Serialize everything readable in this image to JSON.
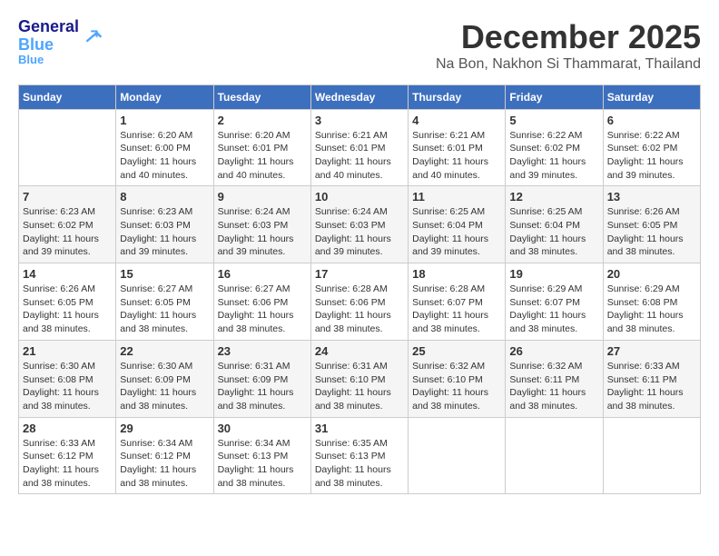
{
  "header": {
    "logo_line1": "General",
    "logo_line2": "Blue",
    "month": "December 2025",
    "location": "Na Bon, Nakhon Si Thammarat, Thailand"
  },
  "days_of_week": [
    "Sunday",
    "Monday",
    "Tuesday",
    "Wednesday",
    "Thursday",
    "Friday",
    "Saturday"
  ],
  "weeks": [
    [
      {
        "day": "",
        "info": ""
      },
      {
        "day": "1",
        "info": "Sunrise: 6:20 AM\nSunset: 6:00 PM\nDaylight: 11 hours\nand 40 minutes."
      },
      {
        "day": "2",
        "info": "Sunrise: 6:20 AM\nSunset: 6:01 PM\nDaylight: 11 hours\nand 40 minutes."
      },
      {
        "day": "3",
        "info": "Sunrise: 6:21 AM\nSunset: 6:01 PM\nDaylight: 11 hours\nand 40 minutes."
      },
      {
        "day": "4",
        "info": "Sunrise: 6:21 AM\nSunset: 6:01 PM\nDaylight: 11 hours\nand 40 minutes."
      },
      {
        "day": "5",
        "info": "Sunrise: 6:22 AM\nSunset: 6:02 PM\nDaylight: 11 hours\nand 39 minutes."
      },
      {
        "day": "6",
        "info": "Sunrise: 6:22 AM\nSunset: 6:02 PM\nDaylight: 11 hours\nand 39 minutes."
      }
    ],
    [
      {
        "day": "7",
        "info": "Sunrise: 6:23 AM\nSunset: 6:02 PM\nDaylight: 11 hours\nand 39 minutes."
      },
      {
        "day": "8",
        "info": "Sunrise: 6:23 AM\nSunset: 6:03 PM\nDaylight: 11 hours\nand 39 minutes."
      },
      {
        "day": "9",
        "info": "Sunrise: 6:24 AM\nSunset: 6:03 PM\nDaylight: 11 hours\nand 39 minutes."
      },
      {
        "day": "10",
        "info": "Sunrise: 6:24 AM\nSunset: 6:03 PM\nDaylight: 11 hours\nand 39 minutes."
      },
      {
        "day": "11",
        "info": "Sunrise: 6:25 AM\nSunset: 6:04 PM\nDaylight: 11 hours\nand 39 minutes."
      },
      {
        "day": "12",
        "info": "Sunrise: 6:25 AM\nSunset: 6:04 PM\nDaylight: 11 hours\nand 38 minutes."
      },
      {
        "day": "13",
        "info": "Sunrise: 6:26 AM\nSunset: 6:05 PM\nDaylight: 11 hours\nand 38 minutes."
      }
    ],
    [
      {
        "day": "14",
        "info": "Sunrise: 6:26 AM\nSunset: 6:05 PM\nDaylight: 11 hours\nand 38 minutes."
      },
      {
        "day": "15",
        "info": "Sunrise: 6:27 AM\nSunset: 6:05 PM\nDaylight: 11 hours\nand 38 minutes."
      },
      {
        "day": "16",
        "info": "Sunrise: 6:27 AM\nSunset: 6:06 PM\nDaylight: 11 hours\nand 38 minutes."
      },
      {
        "day": "17",
        "info": "Sunrise: 6:28 AM\nSunset: 6:06 PM\nDaylight: 11 hours\nand 38 minutes."
      },
      {
        "day": "18",
        "info": "Sunrise: 6:28 AM\nSunset: 6:07 PM\nDaylight: 11 hours\nand 38 minutes."
      },
      {
        "day": "19",
        "info": "Sunrise: 6:29 AM\nSunset: 6:07 PM\nDaylight: 11 hours\nand 38 minutes."
      },
      {
        "day": "20",
        "info": "Sunrise: 6:29 AM\nSunset: 6:08 PM\nDaylight: 11 hours\nand 38 minutes."
      }
    ],
    [
      {
        "day": "21",
        "info": "Sunrise: 6:30 AM\nSunset: 6:08 PM\nDaylight: 11 hours\nand 38 minutes."
      },
      {
        "day": "22",
        "info": "Sunrise: 6:30 AM\nSunset: 6:09 PM\nDaylight: 11 hours\nand 38 minutes."
      },
      {
        "day": "23",
        "info": "Sunrise: 6:31 AM\nSunset: 6:09 PM\nDaylight: 11 hours\nand 38 minutes."
      },
      {
        "day": "24",
        "info": "Sunrise: 6:31 AM\nSunset: 6:10 PM\nDaylight: 11 hours\nand 38 minutes."
      },
      {
        "day": "25",
        "info": "Sunrise: 6:32 AM\nSunset: 6:10 PM\nDaylight: 11 hours\nand 38 minutes."
      },
      {
        "day": "26",
        "info": "Sunrise: 6:32 AM\nSunset: 6:11 PM\nDaylight: 11 hours\nand 38 minutes."
      },
      {
        "day": "27",
        "info": "Sunrise: 6:33 AM\nSunset: 6:11 PM\nDaylight: 11 hours\nand 38 minutes."
      }
    ],
    [
      {
        "day": "28",
        "info": "Sunrise: 6:33 AM\nSunset: 6:12 PM\nDaylight: 11 hours\nand 38 minutes."
      },
      {
        "day": "29",
        "info": "Sunrise: 6:34 AM\nSunset: 6:12 PM\nDaylight: 11 hours\nand 38 minutes."
      },
      {
        "day": "30",
        "info": "Sunrise: 6:34 AM\nSunset: 6:13 PM\nDaylight: 11 hours\nand 38 minutes."
      },
      {
        "day": "31",
        "info": "Sunrise: 6:35 AM\nSunset: 6:13 PM\nDaylight: 11 hours\nand 38 minutes."
      },
      {
        "day": "",
        "info": ""
      },
      {
        "day": "",
        "info": ""
      },
      {
        "day": "",
        "info": ""
      }
    ]
  ]
}
